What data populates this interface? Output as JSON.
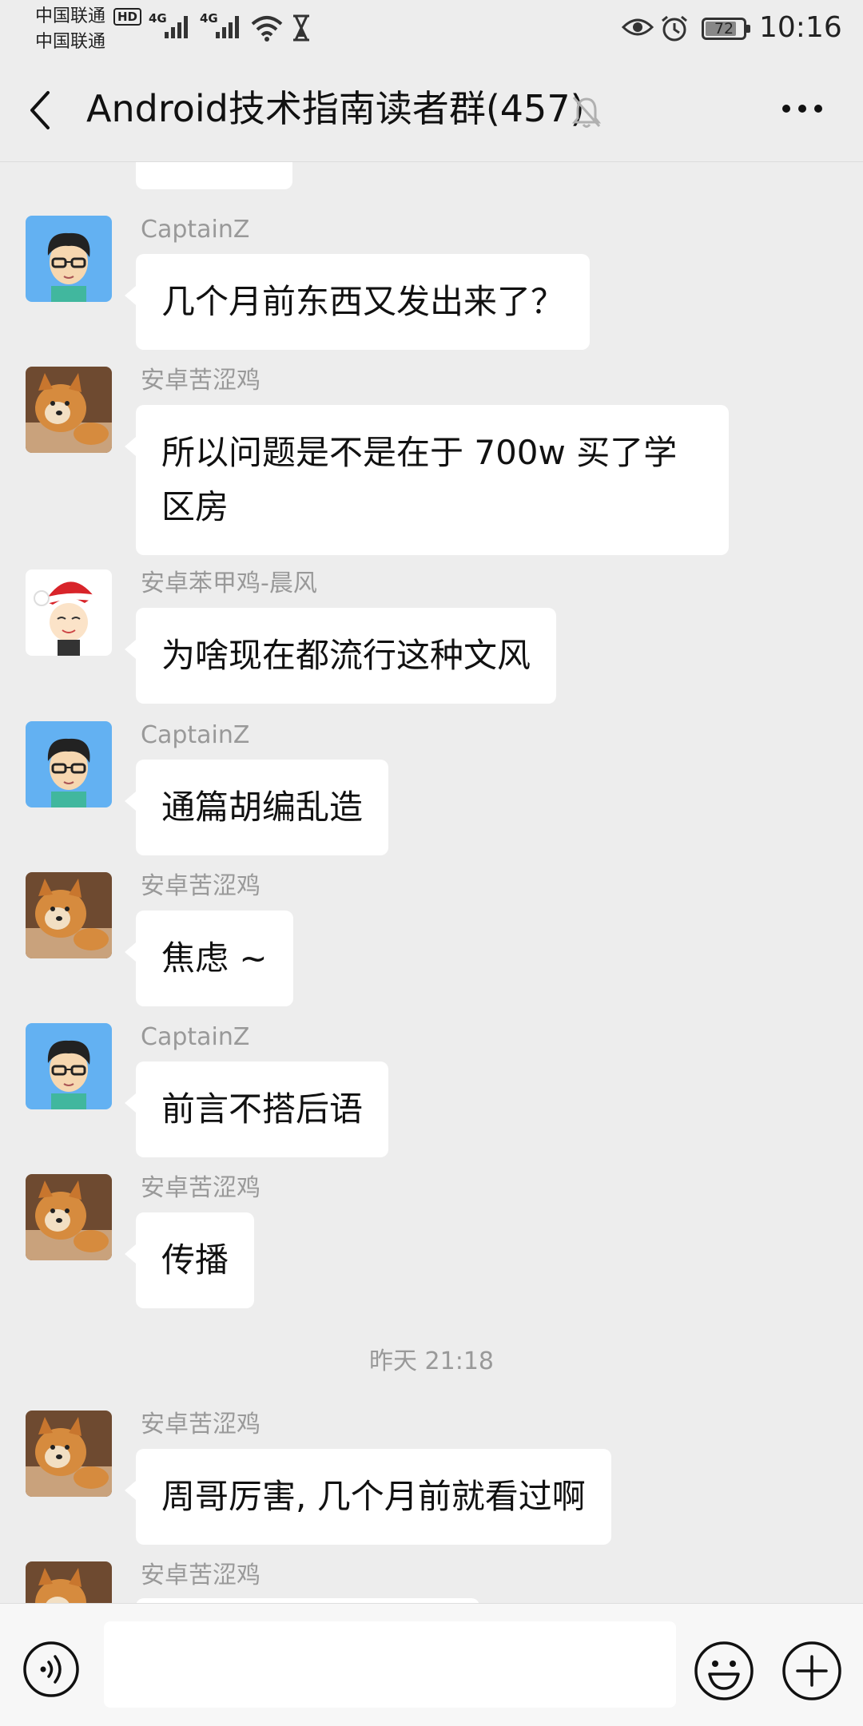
{
  "status_bar": {
    "carrier_1": "中国联通",
    "carrier_2": "中国联通",
    "hd_badge": "HD",
    "net_1": "4G",
    "net_2": "4G",
    "battery": "72",
    "time": "10:16"
  },
  "header": {
    "title": "Android技术指南读者群(457)"
  },
  "messages": [
    {
      "sender": "CaptainZ",
      "text": "几个月前东西又发出来了？"
    },
    {
      "sender": "安卓苦涩鸡",
      "text": "所以问题是不是在于 700w 买了学区房"
    },
    {
      "sender": "安卓苯甲鸡-晨风",
      "text": "为啥现在都流行这种文风"
    },
    {
      "sender": "CaptainZ",
      "text": "通篇胡编乱造"
    },
    {
      "sender": "安卓苦涩鸡",
      "text": "焦虑 ~"
    },
    {
      "sender": "CaptainZ",
      "text": "前言不搭后语"
    },
    {
      "sender": "安卓苦涩鸡",
      "text": "传播"
    },
    {
      "sender": "安卓苦涩鸡",
      "text": "周哥厉害, 几个月前就看过啊"
    },
    {
      "sender": "安卓苦涩鸡",
      "text": ""
    }
  ],
  "timestamp": "昨天 21:18",
  "input": {
    "placeholder": ""
  }
}
